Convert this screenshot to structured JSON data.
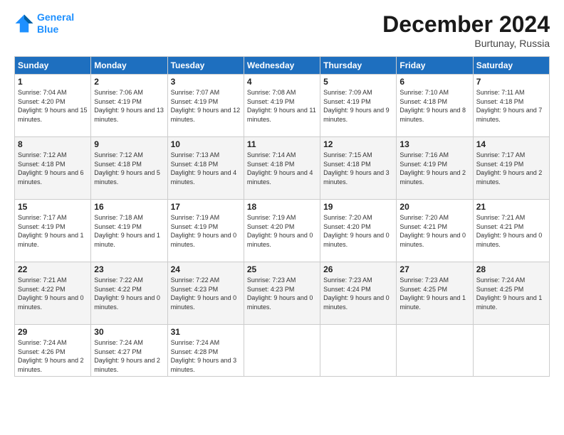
{
  "header": {
    "logo_line1": "General",
    "logo_line2": "Blue",
    "title": "December 2024",
    "location": "Burtunay, Russia"
  },
  "weekdays": [
    "Sunday",
    "Monday",
    "Tuesday",
    "Wednesday",
    "Thursday",
    "Friday",
    "Saturday"
  ],
  "weeks": [
    [
      {
        "day": "1",
        "sunrise": "Sunrise: 7:04 AM",
        "sunset": "Sunset: 4:20 PM",
        "daylight": "Daylight: 9 hours and 15 minutes."
      },
      {
        "day": "2",
        "sunrise": "Sunrise: 7:06 AM",
        "sunset": "Sunset: 4:19 PM",
        "daylight": "Daylight: 9 hours and 13 minutes."
      },
      {
        "day": "3",
        "sunrise": "Sunrise: 7:07 AM",
        "sunset": "Sunset: 4:19 PM",
        "daylight": "Daylight: 9 hours and 12 minutes."
      },
      {
        "day": "4",
        "sunrise": "Sunrise: 7:08 AM",
        "sunset": "Sunset: 4:19 PM",
        "daylight": "Daylight: 9 hours and 11 minutes."
      },
      {
        "day": "5",
        "sunrise": "Sunrise: 7:09 AM",
        "sunset": "Sunset: 4:19 PM",
        "daylight": "Daylight: 9 hours and 9 minutes."
      },
      {
        "day": "6",
        "sunrise": "Sunrise: 7:10 AM",
        "sunset": "Sunset: 4:18 PM",
        "daylight": "Daylight: 9 hours and 8 minutes."
      },
      {
        "day": "7",
        "sunrise": "Sunrise: 7:11 AM",
        "sunset": "Sunset: 4:18 PM",
        "daylight": "Daylight: 9 hours and 7 minutes."
      }
    ],
    [
      {
        "day": "8",
        "sunrise": "Sunrise: 7:12 AM",
        "sunset": "Sunset: 4:18 PM",
        "daylight": "Daylight: 9 hours and 6 minutes."
      },
      {
        "day": "9",
        "sunrise": "Sunrise: 7:12 AM",
        "sunset": "Sunset: 4:18 PM",
        "daylight": "Daylight: 9 hours and 5 minutes."
      },
      {
        "day": "10",
        "sunrise": "Sunrise: 7:13 AM",
        "sunset": "Sunset: 4:18 PM",
        "daylight": "Daylight: 9 hours and 4 minutes."
      },
      {
        "day": "11",
        "sunrise": "Sunrise: 7:14 AM",
        "sunset": "Sunset: 4:18 PM",
        "daylight": "Daylight: 9 hours and 4 minutes."
      },
      {
        "day": "12",
        "sunrise": "Sunrise: 7:15 AM",
        "sunset": "Sunset: 4:18 PM",
        "daylight": "Daylight: 9 hours and 3 minutes."
      },
      {
        "day": "13",
        "sunrise": "Sunrise: 7:16 AM",
        "sunset": "Sunset: 4:19 PM",
        "daylight": "Daylight: 9 hours and 2 minutes."
      },
      {
        "day": "14",
        "sunrise": "Sunrise: 7:17 AM",
        "sunset": "Sunset: 4:19 PM",
        "daylight": "Daylight: 9 hours and 2 minutes."
      }
    ],
    [
      {
        "day": "15",
        "sunrise": "Sunrise: 7:17 AM",
        "sunset": "Sunset: 4:19 PM",
        "daylight": "Daylight: 9 hours and 1 minute."
      },
      {
        "day": "16",
        "sunrise": "Sunrise: 7:18 AM",
        "sunset": "Sunset: 4:19 PM",
        "daylight": "Daylight: 9 hours and 1 minute."
      },
      {
        "day": "17",
        "sunrise": "Sunrise: 7:19 AM",
        "sunset": "Sunset: 4:19 PM",
        "daylight": "Daylight: 9 hours and 0 minutes."
      },
      {
        "day": "18",
        "sunrise": "Sunrise: 7:19 AM",
        "sunset": "Sunset: 4:20 PM",
        "daylight": "Daylight: 9 hours and 0 minutes."
      },
      {
        "day": "19",
        "sunrise": "Sunrise: 7:20 AM",
        "sunset": "Sunset: 4:20 PM",
        "daylight": "Daylight: 9 hours and 0 minutes."
      },
      {
        "day": "20",
        "sunrise": "Sunrise: 7:20 AM",
        "sunset": "Sunset: 4:21 PM",
        "daylight": "Daylight: 9 hours and 0 minutes."
      },
      {
        "day": "21",
        "sunrise": "Sunrise: 7:21 AM",
        "sunset": "Sunset: 4:21 PM",
        "daylight": "Daylight: 9 hours and 0 minutes."
      }
    ],
    [
      {
        "day": "22",
        "sunrise": "Sunrise: 7:21 AM",
        "sunset": "Sunset: 4:22 PM",
        "daylight": "Daylight: 9 hours and 0 minutes."
      },
      {
        "day": "23",
        "sunrise": "Sunrise: 7:22 AM",
        "sunset": "Sunset: 4:22 PM",
        "daylight": "Daylight: 9 hours and 0 minutes."
      },
      {
        "day": "24",
        "sunrise": "Sunrise: 7:22 AM",
        "sunset": "Sunset: 4:23 PM",
        "daylight": "Daylight: 9 hours and 0 minutes."
      },
      {
        "day": "25",
        "sunrise": "Sunrise: 7:23 AM",
        "sunset": "Sunset: 4:23 PM",
        "daylight": "Daylight: 9 hours and 0 minutes."
      },
      {
        "day": "26",
        "sunrise": "Sunrise: 7:23 AM",
        "sunset": "Sunset: 4:24 PM",
        "daylight": "Daylight: 9 hours and 0 minutes."
      },
      {
        "day": "27",
        "sunrise": "Sunrise: 7:23 AM",
        "sunset": "Sunset: 4:25 PM",
        "daylight": "Daylight: 9 hours and 1 minute."
      },
      {
        "day": "28",
        "sunrise": "Sunrise: 7:24 AM",
        "sunset": "Sunset: 4:25 PM",
        "daylight": "Daylight: 9 hours and 1 minute."
      }
    ],
    [
      {
        "day": "29",
        "sunrise": "Sunrise: 7:24 AM",
        "sunset": "Sunset: 4:26 PM",
        "daylight": "Daylight: 9 hours and 2 minutes."
      },
      {
        "day": "30",
        "sunrise": "Sunrise: 7:24 AM",
        "sunset": "Sunset: 4:27 PM",
        "daylight": "Daylight: 9 hours and 2 minutes."
      },
      {
        "day": "31",
        "sunrise": "Sunrise: 7:24 AM",
        "sunset": "Sunset: 4:28 PM",
        "daylight": "Daylight: 9 hours and 3 minutes."
      },
      null,
      null,
      null,
      null
    ]
  ]
}
